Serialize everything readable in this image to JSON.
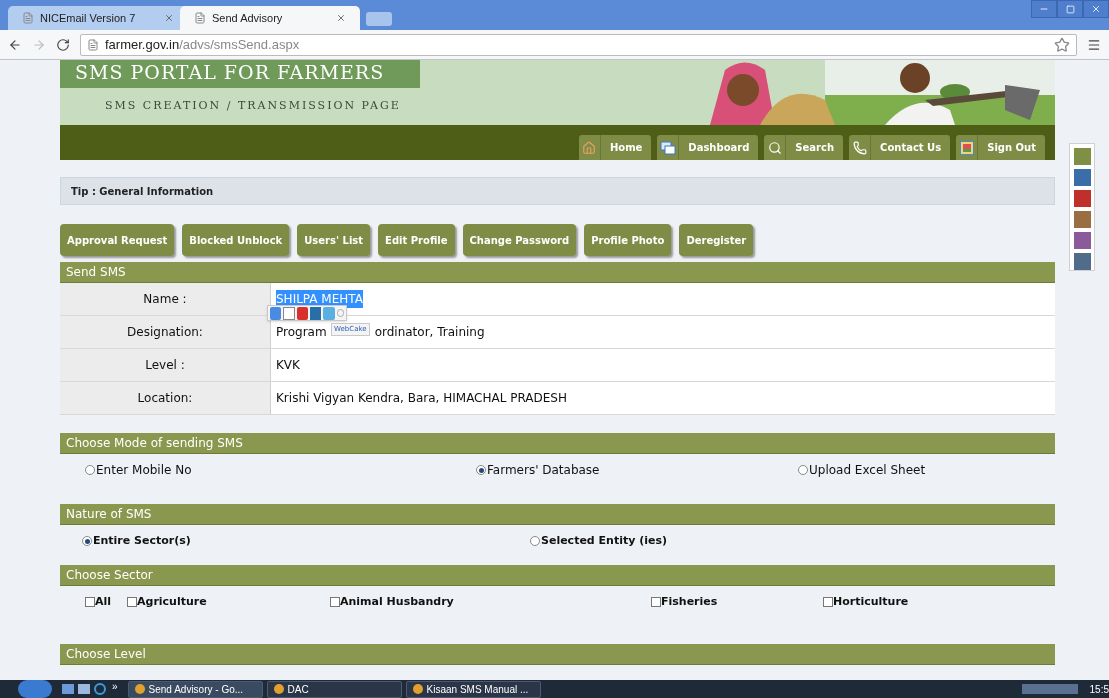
{
  "browser": {
    "tabs": [
      {
        "title": "NICEmail Version 7",
        "selected": false
      },
      {
        "title": "Send Advisory",
        "selected": true
      }
    ],
    "url_host": "farmer.gov.in",
    "url_path": "/advs/smsSend.aspx"
  },
  "header": {
    "title": "SMS PORTAL FOR FARMERS",
    "subtitle": "SMS CREATION / TRANSMISSION PAGE"
  },
  "nav": [
    {
      "kind": "home",
      "label": "Home"
    },
    {
      "kind": "windows",
      "label": "Dashboard"
    },
    {
      "kind": "search",
      "label": "Search"
    },
    {
      "kind": "phone",
      "label": "Contact Us"
    },
    {
      "kind": "picture",
      "label": "Sign Out"
    }
  ],
  "theme_colors": [
    {
      "color": "#7f8f45"
    },
    {
      "color": "#3a6ea8"
    },
    {
      "color": "#c0302a"
    },
    {
      "color": "#9a6e42"
    },
    {
      "color": "#8a5a9a"
    },
    {
      "color": "#4f6d8a"
    }
  ],
  "tip": "Tip : General Information",
  "actions": [
    "Approval Request",
    "Blocked Unblock",
    "Users' List",
    "Edit Profile",
    "Change Password",
    "Profile Photo",
    "Deregister"
  ],
  "send_sms": {
    "title": "Send SMS",
    "rows": [
      {
        "label": "Name :",
        "value": [
          "SHILPA MEHTA"
        ],
        "highlighted": true
      },
      {
        "label": "Designation:",
        "value": [
          "Program",
          "ordinator, Training"
        ],
        "highlighted": false
      },
      {
        "label": "Level :",
        "value": [
          "KVK"
        ],
        "highlighted": false
      },
      {
        "label": "Location:",
        "value": [
          "Krishi Vigyan Kendra, Bara, HIMACHAL PRADESH"
        ],
        "highlighted": false
      }
    ]
  },
  "popup": {
    "caption": "WebCake"
  },
  "mode": {
    "title": "Choose Mode of sending SMS",
    "options": [
      {
        "label": "Enter Mobile No",
        "selected": false
      },
      {
        "label": "Farmers' Database",
        "selected": true
      },
      {
        "label": "Upload Excel Sheet",
        "selected": false
      }
    ]
  },
  "nature": {
    "title": "Nature of SMS",
    "options": [
      {
        "label": "Entire Sector(s)",
        "selected": true
      },
      {
        "label": "Selected Entity (ies)",
        "selected": false
      }
    ]
  },
  "sector": {
    "title": "Choose Sector",
    "options": [
      {
        "label": "All",
        "checked": false
      },
      {
        "label": "Agriculture",
        "checked": false
      },
      {
        "label": "Animal Husbandry",
        "checked": false
      },
      {
        "label": "Fisheries",
        "checked": false
      },
      {
        "label": "Horticulture",
        "checked": false
      }
    ]
  },
  "level": {
    "title": "Choose Level"
  },
  "taskbar": {
    "tasks": [
      {
        "label": "Send Advisory - Go...",
        "selected": true
      },
      {
        "label": "DAC",
        "selected": false
      },
      {
        "label": "Kisaan SMS Manual ...",
        "selected": false
      }
    ],
    "chevron": "»",
    "clock": "15:5"
  }
}
